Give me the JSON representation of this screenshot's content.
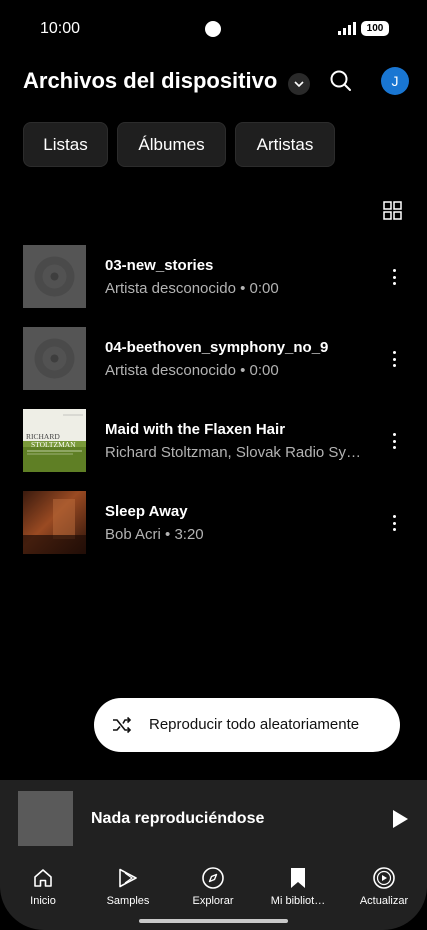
{
  "status_bar": {
    "time": "10:00",
    "battery": "100"
  },
  "header": {
    "title": "Archivos del dispositivo",
    "avatar_letter": "J"
  },
  "chips": [
    "Listas",
    "Álbumes",
    "Artistas"
  ],
  "tracks": [
    {
      "title": "03-new_stories",
      "subtitle": "Artista desconocido • 0:00"
    },
    {
      "title": "04-beethoven_symphony_no_9",
      "subtitle": "Artista desconocido • 0:00"
    },
    {
      "title": "Maid with the Flaxen Hair",
      "subtitle": "Richard Stoltzman, Slovak Radio Symphony Orchestra",
      "art_text_1": "RICHARD",
      "art_text_2": "STOLTZMAN"
    },
    {
      "title": "Sleep Away",
      "subtitle": "Bob Acri • 3:20"
    }
  ],
  "shuffle": {
    "label": "Reproducir todo aleatoriamente"
  },
  "mini_player": {
    "title": "Nada reproduciéndose"
  },
  "nav": {
    "items": [
      {
        "label": "Inicio",
        "icon": "home-icon"
      },
      {
        "label": "Samples",
        "icon": "samples-icon"
      },
      {
        "label": "Explorar",
        "icon": "compass-icon"
      },
      {
        "label": "Mi bibliot…",
        "icon": "bookmark-icon"
      },
      {
        "label": "Actualizar",
        "icon": "upgrade-icon"
      }
    ]
  },
  "colors": {
    "background": "#000000",
    "chip": "#1f1f1f",
    "mini_player": "#212121",
    "avatar": "#1976d2",
    "secondary_text": "#b3b3b3"
  }
}
